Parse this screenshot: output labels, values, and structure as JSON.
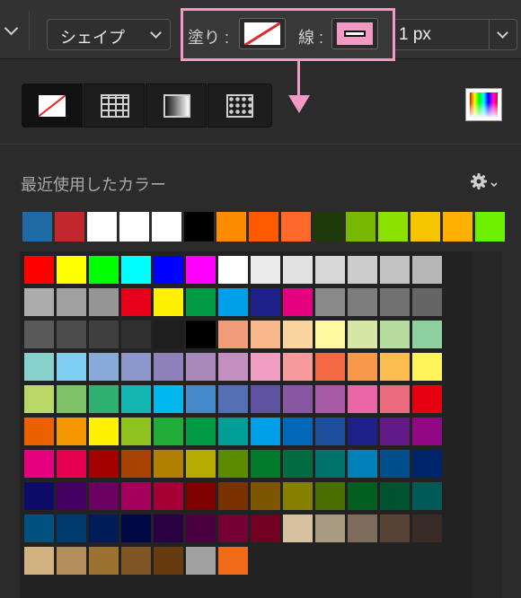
{
  "toolbar": {
    "shape_dropdown": "シェイプ",
    "fill_label": "塗り :",
    "stroke_label": "線 :",
    "stroke_width": "1 px"
  },
  "panel": {
    "recent_title": "最近使用したカラー",
    "gear_icon": "gear-icon"
  },
  "colors": {
    "highlight": "#f39ac4",
    "no_color_slash": "#e0282a"
  },
  "recent_colors": [
    "#1f6aa5",
    "#c1272d",
    "#ffffff",
    "#ffffff",
    "#ffffff",
    "#000000",
    "#ff8c00",
    "#ff5a00",
    "#ff6a2a",
    "#1e3a0a",
    "#78b900",
    "#8be000",
    "#f7c500",
    "#ffb000",
    "#6cf000"
  ],
  "palette_rows": [
    [
      "#ff0000",
      "#ffff00",
      "#00ff00",
      "#00ffff",
      "#0000ff",
      "#ff00ff",
      "#ffffff",
      "#ebebeb",
      "#e1e1e1",
      "#d7d7d7",
      "#cccccc",
      "#c2c2c2",
      "#b7b7b7"
    ],
    [
      "#acacac",
      "#a0a0a0",
      "#959595",
      "#e6001a",
      "#fff100",
      "#009944",
      "#00a0e9",
      "#1d2088",
      "#e4007f",
      "#898989",
      "#7d7d7d",
      "#717171",
      "#656565"
    ],
    [
      "#595959",
      "#4c4c4c",
      "#3f3f3f",
      "#303030",
      "#1e1e1e",
      "#000000",
      "#f29c7a",
      "#f8b88b",
      "#fad49e",
      "#fff89e",
      "#d6e6a4",
      "#b5dc9e",
      "#8fd0a0"
    ],
    [
      "#88d0cc",
      "#7ecef4",
      "#88abda",
      "#8c97cb",
      "#8f82bc",
      "#aa89bd",
      "#c490bf",
      "#f19ec2",
      "#f5999d",
      "#f26943",
      "#f7984b",
      "#fcbc50",
      "#fff45c"
    ],
    [
      "#b9d867",
      "#7fc169",
      "#2eb070",
      "#13b5b1",
      "#00b7ee",
      "#448aca",
      "#556fb5",
      "#5f52a0",
      "#8957a1",
      "#a75ba5",
      "#ea66a6",
      "#ec6a7e",
      "#e60012"
    ],
    [
      "#eb6100",
      "#f39800",
      "#fff100",
      "#8fc31f",
      "#22ac38",
      "#009944",
      "#009e96",
      "#00a0e9",
      "#0068b7",
      "#1d4e9b",
      "#1d2088",
      "#601986",
      "#920783"
    ],
    [
      "#e4007f",
      "#e5004f",
      "#a40000",
      "#a84200",
      "#b28000",
      "#b7aa00",
      "#5b8c00",
      "#007a2b",
      "#006c3f",
      "#00736d",
      "#0081b8",
      "#004e8c",
      "#00246c"
    ],
    [
      "#0d0c68",
      "#440062",
      "#6a005f",
      "#a4005b",
      "#a40035",
      "#7e0000",
      "#7a3100",
      "#7d5400",
      "#858000",
      "#4a6f00",
      "#005e20",
      "#005330",
      "#005a55"
    ],
    [
      "#00517f",
      "#003a6d",
      "#001c58",
      "#000844",
      "#2a0042",
      "#4a0040",
      "#740036",
      "#720022",
      "#d7c29f",
      "#a99b81",
      "#7d6b5c",
      "#574336",
      "#382b25"
    ],
    [
      "#d3b281",
      "#b28e5a",
      "#9b7230",
      "#7f5623",
      "#673a10",
      "#a0a0a0",
      "#ef6b1a"
    ]
  ]
}
